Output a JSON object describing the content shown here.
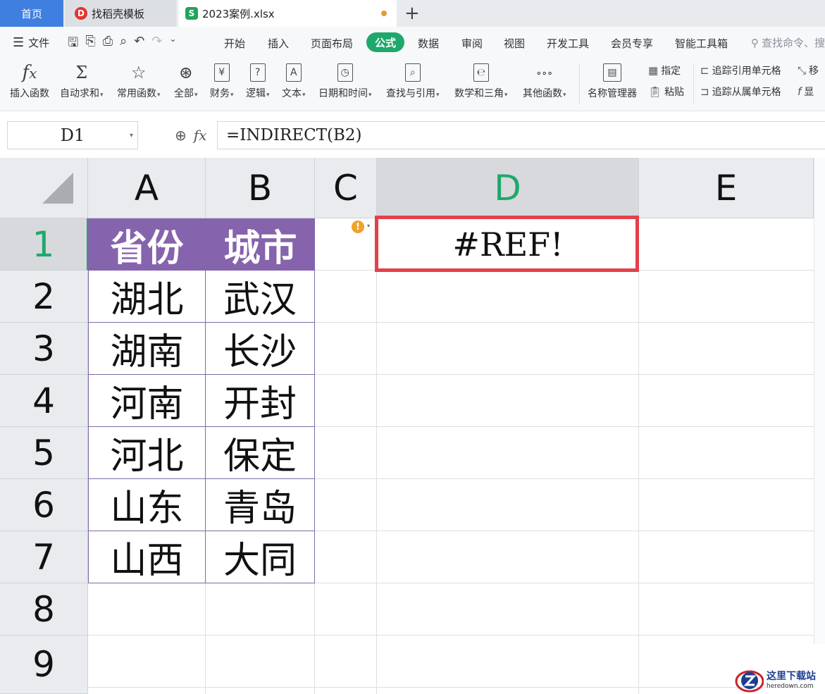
{
  "tabs": {
    "home": "首页",
    "template": "找稻壳模板",
    "file": "2023案例.xlsx",
    "template_logo": "D",
    "file_logo": "S"
  },
  "menu": {
    "file": "文件",
    "items": [
      "开始",
      "插入",
      "页面布局",
      "公式",
      "数据",
      "审阅",
      "视图",
      "开发工具",
      "会员专享",
      "智能工具箱"
    ],
    "active": "公式",
    "search": "查找命令、搜"
  },
  "ribbon": {
    "buttons": [
      {
        "icon": "fx",
        "label": "插入函数",
        "caret": false
      },
      {
        "icon": "Σ",
        "label": "自动求和",
        "caret": true
      },
      {
        "icon": "☆",
        "label": "常用函数",
        "caret": true
      },
      {
        "icon": "⊛",
        "label": "全部",
        "caret": true
      },
      {
        "icon": "¥",
        "label": "财务",
        "caret": true
      },
      {
        "icon": "?",
        "label": "逻辑",
        "caret": true
      },
      {
        "icon": "A",
        "label": "文本",
        "caret": true
      },
      {
        "icon": "◷",
        "label": "日期和时间",
        "caret": true
      },
      {
        "icon": "⌕",
        "label": "查找与引用",
        "caret": true
      },
      {
        "icon": "℮",
        "label": "数学和三角",
        "caret": true
      },
      {
        "icon": "∘∘∘",
        "label": "其他函数",
        "caret": true
      },
      {
        "icon": "▤",
        "label": "名称管理器",
        "caret": false
      }
    ],
    "small": {
      "specify": "指定",
      "paste": "粘贴",
      "trace_precedents": "追踪引用单元格",
      "trace_dependents": "追踪从属单元格",
      "move": "移",
      "show": "显"
    }
  },
  "formula_bar": {
    "name_box": "D1",
    "formula": "=INDIRECT(B2)"
  },
  "sheet": {
    "columns": [
      "A",
      "B",
      "C",
      "D",
      "E"
    ],
    "active_column": "D",
    "rows": [
      "1",
      "2",
      "3",
      "4",
      "5",
      "6",
      "7",
      "8",
      "9"
    ],
    "active_row": "1",
    "header": [
      "省份",
      "城市"
    ],
    "data": [
      [
        "湖北",
        "武汉"
      ],
      [
        "湖南",
        "长沙"
      ],
      [
        "河南",
        "开封"
      ],
      [
        "河北",
        "保定"
      ],
      [
        "山东",
        "青岛"
      ],
      [
        "山西",
        "大同"
      ]
    ],
    "d1_value": "#REF!",
    "warning_symbol": "!"
  },
  "watermark": {
    "cn": "这里下载站",
    "en": "heredown.com"
  },
  "colors": {
    "accent_green": "#1fa86b",
    "header_purple": "#8663ad",
    "selection_red": "#e5404a",
    "tab_blue": "#3f7fe0"
  }
}
